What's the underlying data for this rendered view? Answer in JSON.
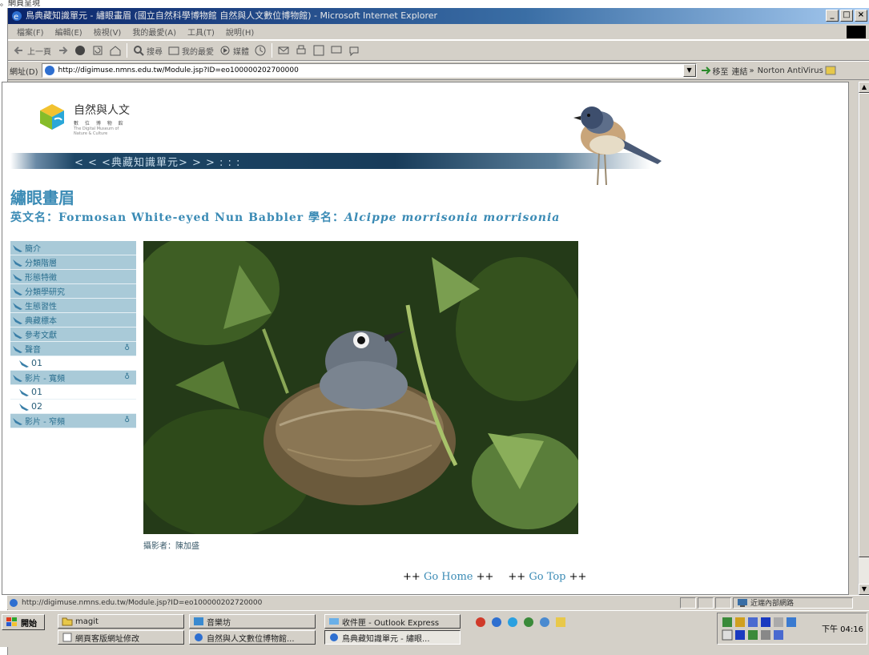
{
  "page_caption": "。網頁呈現",
  "window": {
    "title": "鳥典藏知識單元 - 繡眼畫眉 (國立自然科學博物館 自然與人文數位博物館) - Microsoft Internet Explorer",
    "buttons": [
      "_",
      "□",
      "×"
    ]
  },
  "menu": [
    "檔案(F)",
    "編輯(E)",
    "檢視(V)",
    "我的最愛(A)",
    "工具(T)",
    "說明(H)"
  ],
  "toolbar": {
    "back": "上一頁",
    "search": "搜尋",
    "favorites": "我的最愛",
    "media": "媒體"
  },
  "address": {
    "label": "網址(D)",
    "url": "http://digimuse.nmns.edu.tw/Module.jsp?ID=eo100000202700000",
    "go": "移至",
    "links": "連結",
    "links_more": "»",
    "norton": "Norton AntiVirus"
  },
  "site": {
    "logo_title": "自然與人文",
    "logo_sub1": "數 位 博 物 館",
    "logo_sub2_line1": "The Digital Museum of",
    "logo_sub2_line2": "Nature & Culture",
    "banner": "< < <典藏知識單元> > > : : :"
  },
  "species": {
    "title": "繡眼畫眉",
    "en_prefix": "英文名：",
    "en_name": "Formosan White-eyed Nun Babbler",
    "sci_prefix": " 學名：",
    "sci_name": "Alcippe morrisonia morrisonia"
  },
  "sidenav": [
    {
      "label": "簡介",
      "sub": false
    },
    {
      "label": "分類階層",
      "sub": false
    },
    {
      "label": "形態特徵",
      "sub": false
    },
    {
      "label": "分類學研究",
      "sub": false
    },
    {
      "label": "生態習性",
      "sub": false
    },
    {
      "label": "典藏標本",
      "sub": false
    },
    {
      "label": "參考文獻",
      "sub": false
    },
    {
      "label": "聲音",
      "sub": false,
      "arrow": true
    },
    {
      "label": "01",
      "sub": true
    },
    {
      "label": "影片 - 寬頻",
      "sub": false,
      "arrow": true
    },
    {
      "label": "01",
      "sub": true
    },
    {
      "label": "02",
      "sub": true
    },
    {
      "label": "影片 - 窄頻",
      "sub": false,
      "arrow": true
    }
  ],
  "photo_credit": "攝影者：陳加盛",
  "footer": {
    "plus": "++",
    "home": "Go Home",
    "top": "Go Top"
  },
  "status": {
    "url": "http://digimuse.nmns.edu.tw/Module.jsp?ID=eo100000202720000",
    "zone": "近端內部網路"
  },
  "taskbar": {
    "start": "開始",
    "buttons": [
      {
        "label": "magit",
        "active": false
      },
      {
        "label": "音樂坊",
        "active": false
      },
      {
        "label": "收件匣 - Outlook Express",
        "active": false
      },
      {
        "label": "網頁客版網址修改",
        "active": false
      },
      {
        "label": "自然與人文數位博物館...",
        "active": false
      },
      {
        "label": "鳥典藏知識單元 - 繡眼...",
        "active": true
      }
    ],
    "clock": "下午 04:16"
  },
  "colors": {
    "accent": "#3b8bb5",
    "nav_bg": "#a9cad8",
    "banner": "#1d4666",
    "titlebar": "#0a246a"
  }
}
